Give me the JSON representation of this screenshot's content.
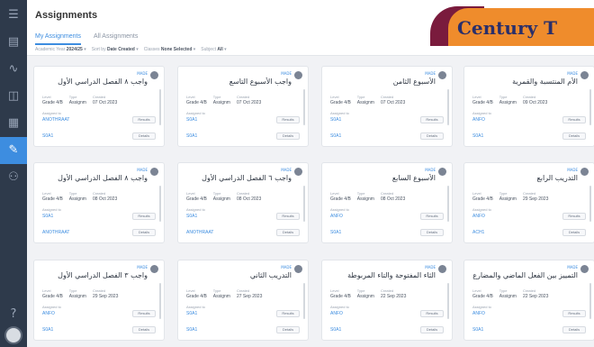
{
  "header": {
    "title": "Assignments",
    "tabs": [
      "My Assignments",
      "All Assignments"
    ],
    "filters": [
      {
        "label": "Academic Year",
        "value": "2024/25"
      },
      {
        "label": "Sort by",
        "value": "Date Created"
      },
      {
        "label": "Classes",
        "value": "None Selected"
      },
      {
        "label": "Subject",
        "value": "All"
      }
    ]
  },
  "logo": {
    "text": "Century T"
  },
  "card_common": {
    "status": "MADE",
    "level_label": "Level",
    "type_label": "Type",
    "created_label": "Created",
    "level": "Grade 4/B",
    "type": "Assignm",
    "assigned_label": "Assigned to",
    "results_label": "Results",
    "results2_label": "Details"
  },
  "cards": [
    {
      "title": "واجب ٨ الفصل الدراسي الأول",
      "date": "07 Oct 2023",
      "link1": "ANOTHRAAT",
      "link2": "S0A1"
    },
    {
      "title": "واجب الأسبوع التاسع",
      "date": "07 Oct 2023",
      "link1": "S0A1",
      "link2": "S0A1"
    },
    {
      "title": "الأسبوع الثامن",
      "date": "07 Oct 2023",
      "link1": "S0A1",
      "link2": "S0A1"
    },
    {
      "title": "الأم المنتسبة والقمرية",
      "date": "09 Oct 2023",
      "link1": "ANFO",
      "link2": "S0A1"
    },
    {
      "title": "واجب ٨ الفصل الدراسي الأول",
      "date": "08 Oct 2023",
      "link1": "S0A1",
      "link2": "ANOTHRAAT"
    },
    {
      "title": "واجب ٦ الفصل الدراسي الأول",
      "date": "08 Oct 2023",
      "link1": "S0A1",
      "link2": "ANOTHRAAT"
    },
    {
      "title": "الأسبوع السابع",
      "date": "08 Oct 2023",
      "link1": "ANFO",
      "link2": "S0A1"
    },
    {
      "title": "التدريب الرابع",
      "date": "29 Sep 2023",
      "link1": "ANFO",
      "link2": "ACH1"
    },
    {
      "title": "واجب ٣ الفصل الدراسي الأول",
      "date": "29 Sep 2023",
      "link1": "ANFO",
      "link2": "S0A1"
    },
    {
      "title": "التدريب الثاني",
      "date": "27 Sep 2023",
      "link1": "S0A1",
      "link2": "S0A1"
    },
    {
      "title": "الثاء المفتوحة والتاء المربوطة",
      "date": "22 Sep 2023",
      "link1": "ANFO",
      "link2": "S0A1"
    },
    {
      "title": "التمييز بين الفعل الماضي والمضارع",
      "date": "22 Sep 2023",
      "link1": "ANFO",
      "link2": "S0A1"
    }
  ]
}
